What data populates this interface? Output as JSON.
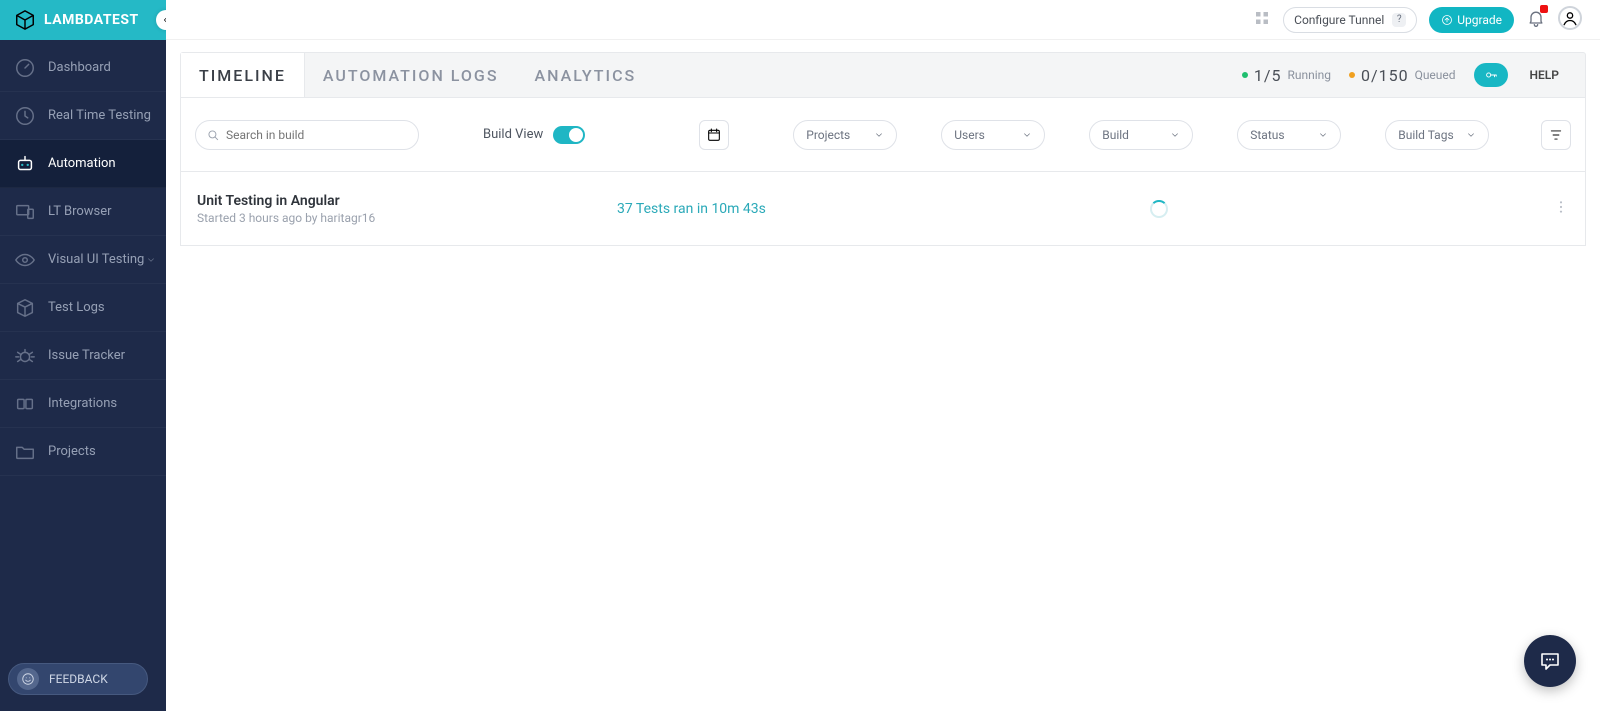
{
  "brand": "LAMBDATEST",
  "sidebar": {
    "items": [
      {
        "label": "Dashboard"
      },
      {
        "label": "Real Time Testing"
      },
      {
        "label": "Automation"
      },
      {
        "label": "LT Browser"
      },
      {
        "label": "Visual UI Testing"
      },
      {
        "label": "Test Logs"
      },
      {
        "label": "Issue Tracker"
      },
      {
        "label": "Integrations"
      },
      {
        "label": "Projects"
      }
    ],
    "feedback": "FEEDBACK"
  },
  "topbar": {
    "configure_tunnel": "Configure Tunnel",
    "upgrade": "Upgrade"
  },
  "tabs": {
    "timeline": "TIMELINE",
    "automation_logs": "AUTOMATION LOGS",
    "analytics": "ANALYTICS"
  },
  "stats": {
    "running_count": "1/5",
    "running_label": "Running",
    "queued_count": "0/150",
    "queued_label": "Queued",
    "running_color": "#1fbf6f",
    "queued_color": "#f0a020"
  },
  "help": "HELP",
  "filters": {
    "search_placeholder": "Search in build",
    "build_view_label": "Build View",
    "projects": "Projects",
    "users": "Users",
    "build": "Build",
    "status": "Status",
    "build_tags": "Build Tags"
  },
  "build": {
    "title": "Unit Testing in Angular",
    "subtitle": "Started 3 hours ago by haritagr16",
    "run_stat": "37 Tests ran in 10m 43s"
  }
}
